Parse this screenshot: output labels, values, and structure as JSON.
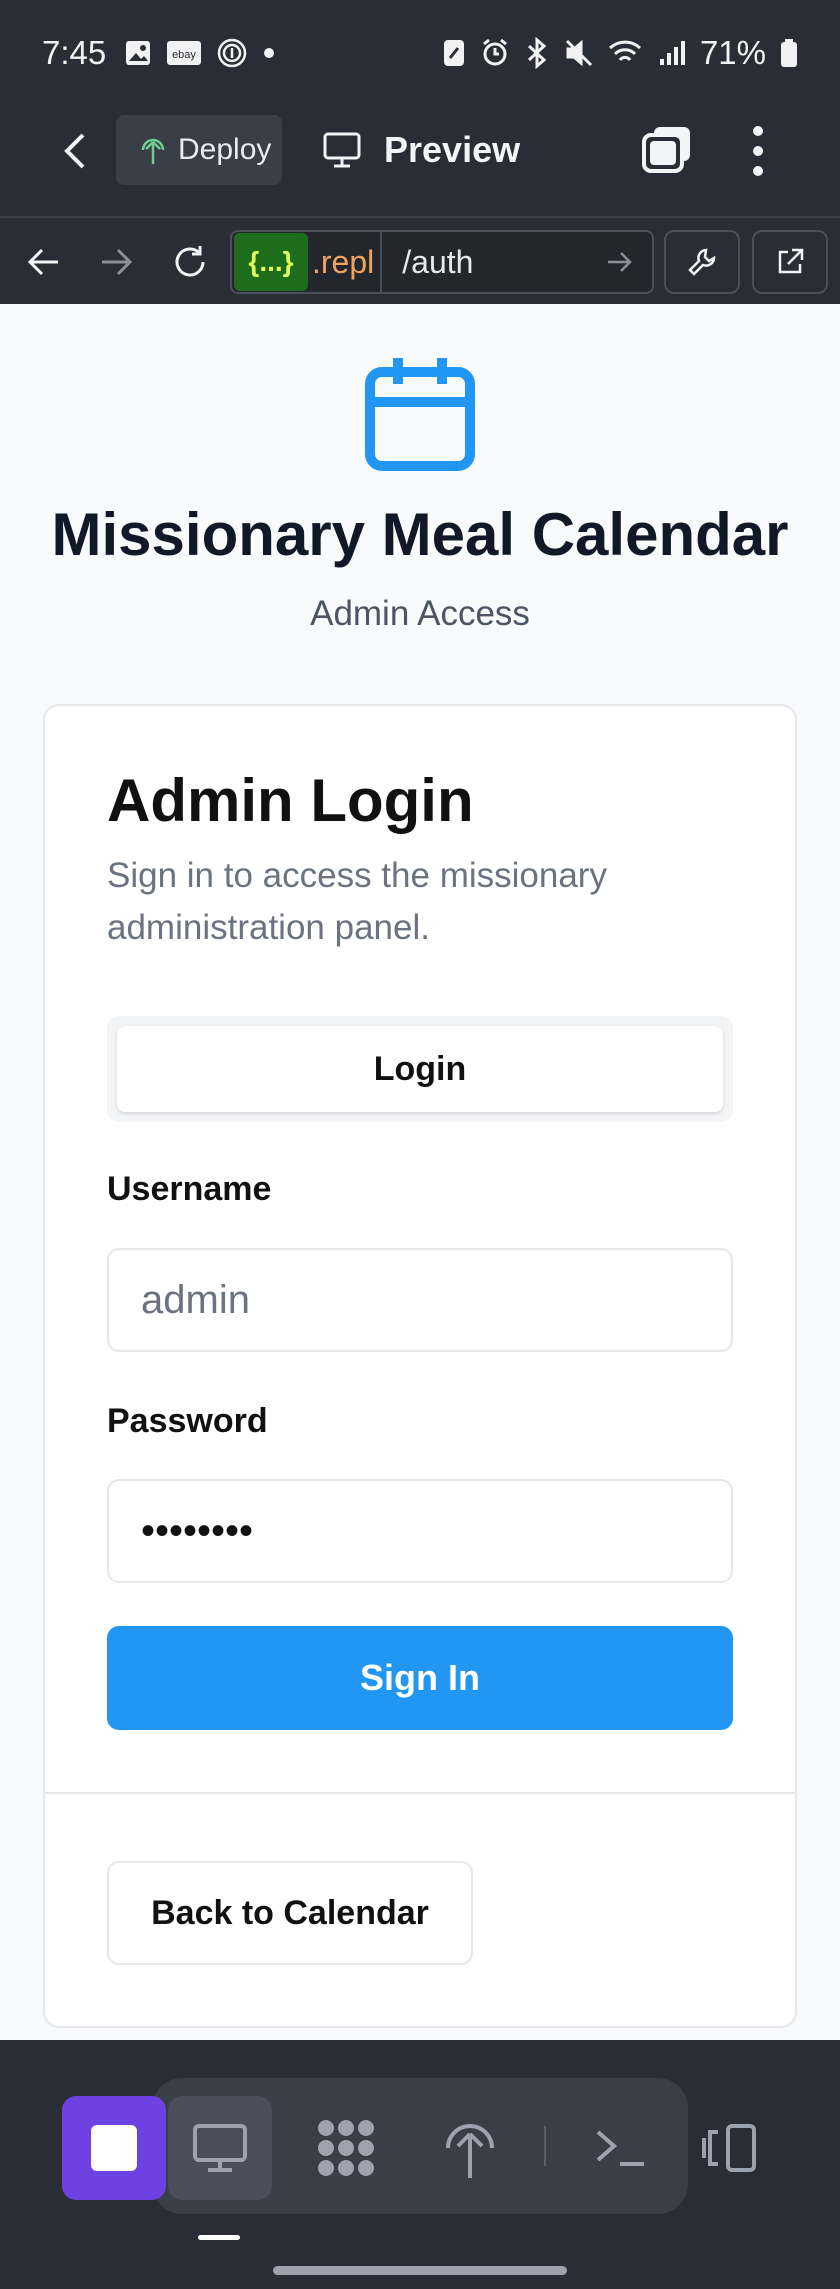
{
  "status_bar": {
    "time": "7:45",
    "battery": "71%",
    "left_icons": [
      "image-icon",
      "ebay-icon",
      "fingerprint-icon",
      "dot-icon"
    ],
    "right_icons": [
      "nfc-icon",
      "alarm-icon",
      "bluetooth-icon",
      "mute-icon",
      "wifi-icon",
      "signal-icon",
      "battery-icon"
    ]
  },
  "header": {
    "deploy_label": "Deploy",
    "preview_label": "Preview"
  },
  "browser": {
    "logo_text": "{...}",
    "domain_text": ".repl",
    "path": "/auth"
  },
  "page": {
    "title": "Missionary Meal Calendar",
    "subtitle": "Admin Access",
    "card": {
      "title": "Admin Login",
      "description": "Sign in to access the missionary administration panel.",
      "tab_label": "Login",
      "username_label": "Username",
      "username_placeholder": "admin",
      "password_label": "Password",
      "password_value": "••••••••",
      "signin_label": "Sign In",
      "back_label": "Back to Calendar"
    }
  },
  "colors": {
    "accent": "#2196f3",
    "replit_purple": "#6e41e2",
    "chrome_bg": "#2a2d35"
  }
}
